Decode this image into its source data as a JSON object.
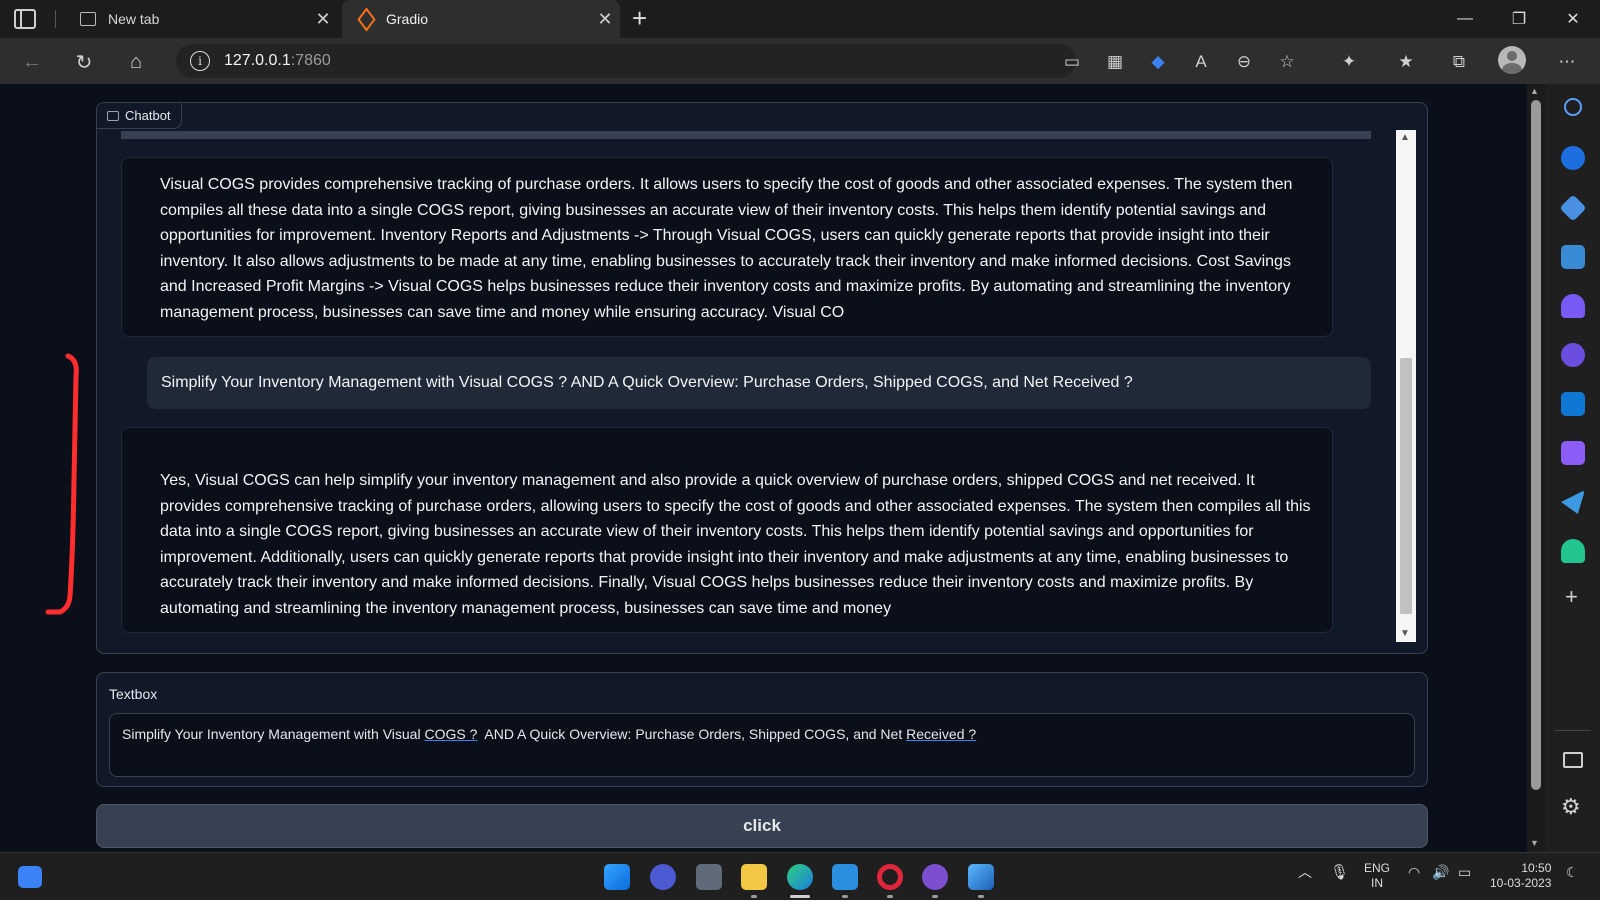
{
  "browser": {
    "tabs": [
      {
        "label": "New tab"
      },
      {
        "label": "Gradio"
      }
    ],
    "url_host": "127.0.0.1",
    "url_port": ":7860"
  },
  "chatbot": {
    "label": "Chatbot",
    "messages": [
      {
        "role": "bot",
        "text": "Visual COGS provides comprehensive tracking of purchase orders. It allows users to specify the cost of goods and other associated expenses. The system then compiles all these data into a single COGS report, giving businesses an accurate view of their inventory costs. This helps them identify potential savings and opportunities for improvement. Inventory Reports and Adjustments -> Through Visual COGS, users can quickly generate reports that provide insight into their inventory. It also allows adjustments to be made at any time, enabling businesses to accurately track their inventory and make informed decisions. Cost Savings and Increased Profit Margins -> Visual COGS helps businesses reduce their inventory costs and maximize profits. By automating and streamlining the inventory management process, businesses can save time and money while ensuring accuracy. Visual CO"
      },
      {
        "role": "user",
        "text": "Simplify Your Inventory Management with Visual COGS ? AND A Quick Overview: Purchase Orders, Shipped COGS, and Net Received ?"
      },
      {
        "role": "bot",
        "text": "Yes, Visual COGS can help simplify your inventory management and also provide a quick overview of purchase orders, shipped COGS and net received. It provides comprehensive tracking of purchase orders, allowing users to specify the cost of goods and other associated expenses. The system then compiles all this data into a single COGS report, giving businesses an accurate view of their inventory costs. This helps them identify potential savings and opportunities for improvement. Additionally, users can quickly generate reports that provide insight into their inventory and make adjustments at any time, enabling businesses to accurately track their inventory and make informed decisions. Finally, Visual COGS helps businesses reduce their inventory costs and maximize profits. By automating and streamlining the inventory management process, businesses can save time and money"
      }
    ]
  },
  "textbox": {
    "label": "Textbox",
    "value_parts": [
      "Simplify Your Inventory Management with Visual ",
      "COGS ?",
      "  AND A Quick Overview: Purchase Orders, Shipped COGS, and Net ",
      "Received ?"
    ]
  },
  "button": {
    "label": "click"
  },
  "taskbar": {
    "lang_line1": "ENG",
    "lang_line2": "IN",
    "time": "10:50",
    "date": "10-03-2023"
  },
  "colors": {
    "page_bg": "#0b0f19",
    "block_bg": "#111827",
    "border": "#374151",
    "user_bubble": "#1f2937",
    "annotation": "#ff2d2d"
  }
}
